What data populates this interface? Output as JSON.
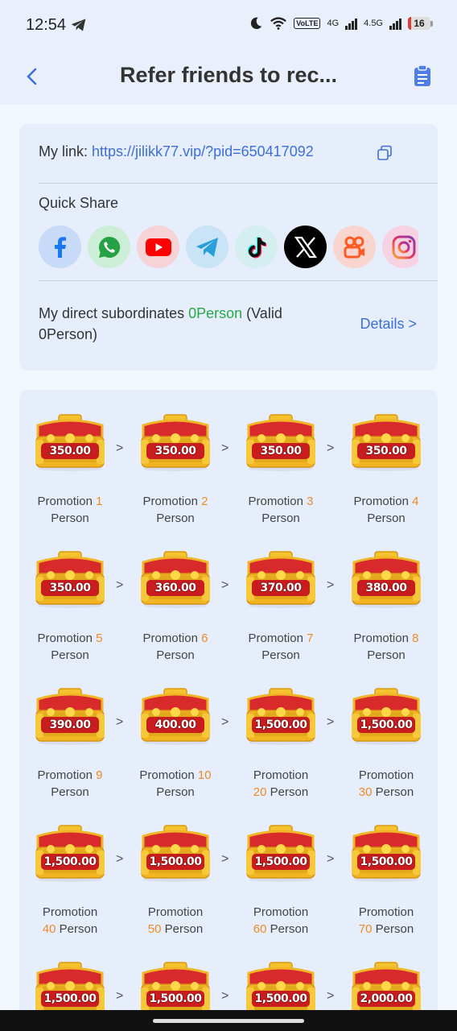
{
  "status": {
    "time": "12:54",
    "volte": "VoLTE",
    "sim1": "4G",
    "sim2": "4.5G",
    "battery": "16",
    "battery_level": 0.16,
    "icons": [
      "telegram-icon",
      "moon-icon",
      "wifi-icon",
      "signal-icon",
      "battery-icon"
    ]
  },
  "header": {
    "title": "Refer friends to rec...",
    "back_icon": "chevron-left-icon",
    "clipboard_icon": "clipboard-icon"
  },
  "link": {
    "label": "My link:",
    "url": "https://jilikk77.vip/?pid=650417092",
    "copy_icon": "copy-icon"
  },
  "quick_share": {
    "label": "Quick Share",
    "platforms": [
      {
        "name": "facebook",
        "bg": "#c7daf7",
        "color": "#1877f2"
      },
      {
        "name": "whatsapp",
        "bg": "#cdeed6",
        "color": "#25a244"
      },
      {
        "name": "youtube",
        "bg": "#f6d3d6",
        "color": "#ff0000"
      },
      {
        "name": "telegram",
        "bg": "#c9e4f6",
        "color": "#2aa0da"
      },
      {
        "name": "tiktok",
        "bg": "#d5eef0",
        "color": "#111111"
      },
      {
        "name": "x",
        "bg": "#000000",
        "color": "#ffffff"
      },
      {
        "name": "kuaishou",
        "bg": "#f8d6cf",
        "color": "#ff5a1f"
      },
      {
        "name": "instagram",
        "bg": "#f5d3e3",
        "color": "#e1306c"
      }
    ]
  },
  "subordinates": {
    "prefix": "My direct subordinates ",
    "count": "0Person",
    "valid_open": " (Valid",
    "valid": "0Person)",
    "details": "Details >"
  },
  "rewards": [
    {
      "amount": "350.00",
      "line1": "Promotion ",
      "num": "1",
      "line2": "Person"
    },
    {
      "amount": "350.00",
      "line1": "Promotion ",
      "num": "2",
      "line2": "Person"
    },
    {
      "amount": "350.00",
      "line1": "Promotion ",
      "num": "3",
      "line2": "Person"
    },
    {
      "amount": "350.00",
      "line1": "Promotion ",
      "num": "4",
      "line2": "Person"
    },
    {
      "amount": "350.00",
      "line1": "Promotion ",
      "num": "5",
      "line2": "Person"
    },
    {
      "amount": "360.00",
      "line1": "Promotion ",
      "num": "6",
      "line2": "Person"
    },
    {
      "amount": "370.00",
      "line1": "Promotion ",
      "num": "7",
      "line2": "Person"
    },
    {
      "amount": "380.00",
      "line1": "Promotion ",
      "num": "8",
      "line2": "Person"
    },
    {
      "amount": "390.00",
      "line1": "Promotion ",
      "num": "9",
      "line2": "Person"
    },
    {
      "amount": "400.00",
      "line1": "Promotion ",
      "num": "10",
      "line2": "Person"
    },
    {
      "amount": "1,500.00",
      "line1": "Promotion",
      "num": "20",
      "line2": " Person",
      "num_second_line": true
    },
    {
      "amount": "1,500.00",
      "line1": "Promotion",
      "num": "30",
      "line2": " Person",
      "num_second_line": true
    },
    {
      "amount": "1,500.00",
      "line1": "Promotion",
      "num": "40",
      "line2": " Person",
      "num_second_line": true
    },
    {
      "amount": "1,500.00",
      "line1": "Promotion",
      "num": "50",
      "line2": " Person",
      "num_second_line": true
    },
    {
      "amount": "1,500.00",
      "line1": "Promotion",
      "num": "60",
      "line2": " Person",
      "num_second_line": true
    },
    {
      "amount": "1,500.00",
      "line1": "Promotion",
      "num": "70",
      "line2": " Person",
      "num_second_line": true
    },
    {
      "amount": "1,500.00"
    },
    {
      "amount": "1,500.00"
    },
    {
      "amount": "1,500.00"
    },
    {
      "amount": "2,000.00"
    }
  ],
  "arrow": ">",
  "colors": {
    "accent": "#3d6fd8",
    "highlight": "#f08a24",
    "valid_green": "#27a844"
  }
}
